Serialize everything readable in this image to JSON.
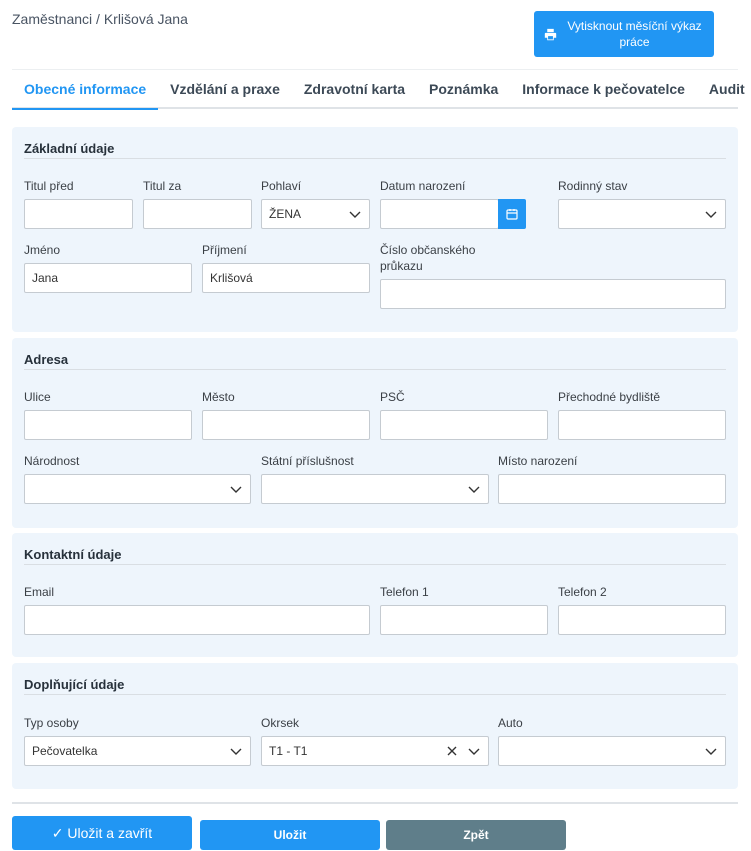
{
  "breadcrumb": "Zaměstnanci / Krlišová Jana",
  "print_button": "Vytisknout měsíční výkaz práce",
  "tabs": [
    "Obecné informace",
    "Vzdělání a praxe",
    "Zdravotní karta",
    "Poznámka",
    "Informace k pečovatelce",
    "Audit"
  ],
  "active_tab": "Obecné informace",
  "basic": {
    "title": "Základní údaje",
    "titul_pred": "Titul před",
    "titul_za": "Titul za",
    "pohlavi": "Pohlaví",
    "pohlavi_value": "ŽENA",
    "datum_narozeni": "Datum narození",
    "rodinny_stav": "Rodinný stav",
    "jmeno": "Jméno",
    "jmeno_value": "Jana",
    "prijmeni": "Příjmení",
    "prijmeni_value": "Krlišová",
    "cislo_op_1": "Číslo občanského",
    "cislo_op_2": "průkazu"
  },
  "address": {
    "title": "Adresa",
    "ulice": "Ulice",
    "mesto": "Město",
    "psc": "PSČ",
    "prechodne": "Přechodné bydliště",
    "narodnost": "Národnost",
    "statni": "Státní příslušnost",
    "misto": "Místo narození"
  },
  "contact": {
    "title": "Kontaktní údaje",
    "email": "Email",
    "telefon1": "Telefon 1",
    "telefon2": "Telefon 2"
  },
  "extra": {
    "title": "Doplňující údaje",
    "typ_osoby": "Typ osoby",
    "typ_osoby_value": "Pečovatelka",
    "okrsek": "Okrsek",
    "okrsek_value": "T1 - T1",
    "auto": "Auto"
  },
  "buttons": {
    "save_close": "✓ Uložit a zavřít",
    "save": "Uložit",
    "back": "Zpět"
  },
  "colors": {
    "accent": "#2196f3",
    "back_button": "#5f7e8a",
    "panel": "#eef5fc"
  }
}
